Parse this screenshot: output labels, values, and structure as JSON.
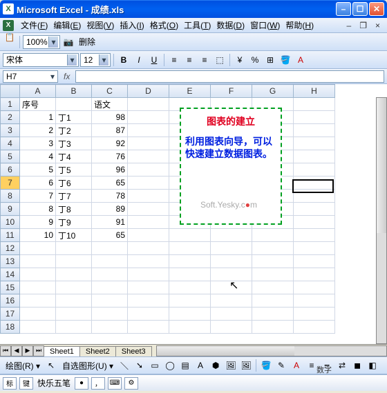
{
  "window": {
    "title": "Microsoft Excel - 成绩.xls",
    "app_icon": "X"
  },
  "menu": {
    "items": [
      {
        "label": "文件",
        "key": "F"
      },
      {
        "label": "编辑",
        "key": "E"
      },
      {
        "label": "视图",
        "key": "V"
      },
      {
        "label": "插入",
        "key": "I"
      },
      {
        "label": "格式",
        "key": "O"
      },
      {
        "label": "工具",
        "key": "T"
      },
      {
        "label": "数据",
        "key": "D"
      },
      {
        "label": "窗口",
        "key": "W"
      },
      {
        "label": "帮助",
        "key": "H"
      }
    ],
    "mdi_close": "×"
  },
  "toolbar": {
    "icons": [
      "📄",
      "📂",
      "💾",
      "🔒",
      "🖨",
      "🔍",
      "✂",
      "📋",
      "📋",
      "↶",
      "↷",
      "🔗",
      "Σ",
      "A↓",
      "📊",
      "🔎",
      "❓"
    ],
    "zoom": "100%",
    "delete_label": "删除"
  },
  "formatbar": {
    "font": "宋体",
    "size": "12",
    "bold": "B",
    "italic": "I",
    "underline": "U"
  },
  "formula": {
    "name_box": "H7",
    "fx": "fx",
    "value": ""
  },
  "grid": {
    "columns": [
      "A",
      "B",
      "C",
      "D",
      "E",
      "F",
      "G",
      "H"
    ],
    "row_count": 18,
    "selected_row": 7,
    "active_cell": {
      "col": "H",
      "row": 7
    },
    "headers_row": 1,
    "data": {
      "r1": {
        "A": "序号",
        "C": "语文"
      },
      "r2": {
        "A": "1",
        "B": "丁1",
        "C": "98"
      },
      "r3": {
        "A": "2",
        "B": "丁2",
        "C": "87"
      },
      "r4": {
        "A": "3",
        "B": "丁3",
        "C": "92"
      },
      "r5": {
        "A": "4",
        "B": "丁4",
        "C": "76"
      },
      "r6": {
        "A": "5",
        "B": "丁5",
        "C": "96"
      },
      "r7": {
        "A": "6",
        "B": "丁6",
        "C": "65"
      },
      "r8": {
        "A": "7",
        "B": "丁7",
        "C": "78"
      },
      "r9": {
        "A": "8",
        "B": "丁8",
        "C": "89"
      },
      "r10": {
        "A": "9",
        "B": "丁9",
        "C": "91"
      },
      "r11": {
        "A": "10",
        "B": "丁10",
        "C": "65"
      }
    }
  },
  "textbox": {
    "title": "图表的建立",
    "body": "利用图表向导，可以快速建立数据图表。"
  },
  "watermark": {
    "text": "Soft.Yesky.c",
    "suffix": "m"
  },
  "sheets": {
    "tabs": [
      "Sheet1",
      "Sheet2",
      "Sheet3"
    ],
    "active": 0
  },
  "drawbar": {
    "draw_label": "绘图(R)",
    "autoshape_label": "自选图形(U)"
  },
  "ime": {
    "name": "快乐五笔",
    "status_label": "数字"
  }
}
